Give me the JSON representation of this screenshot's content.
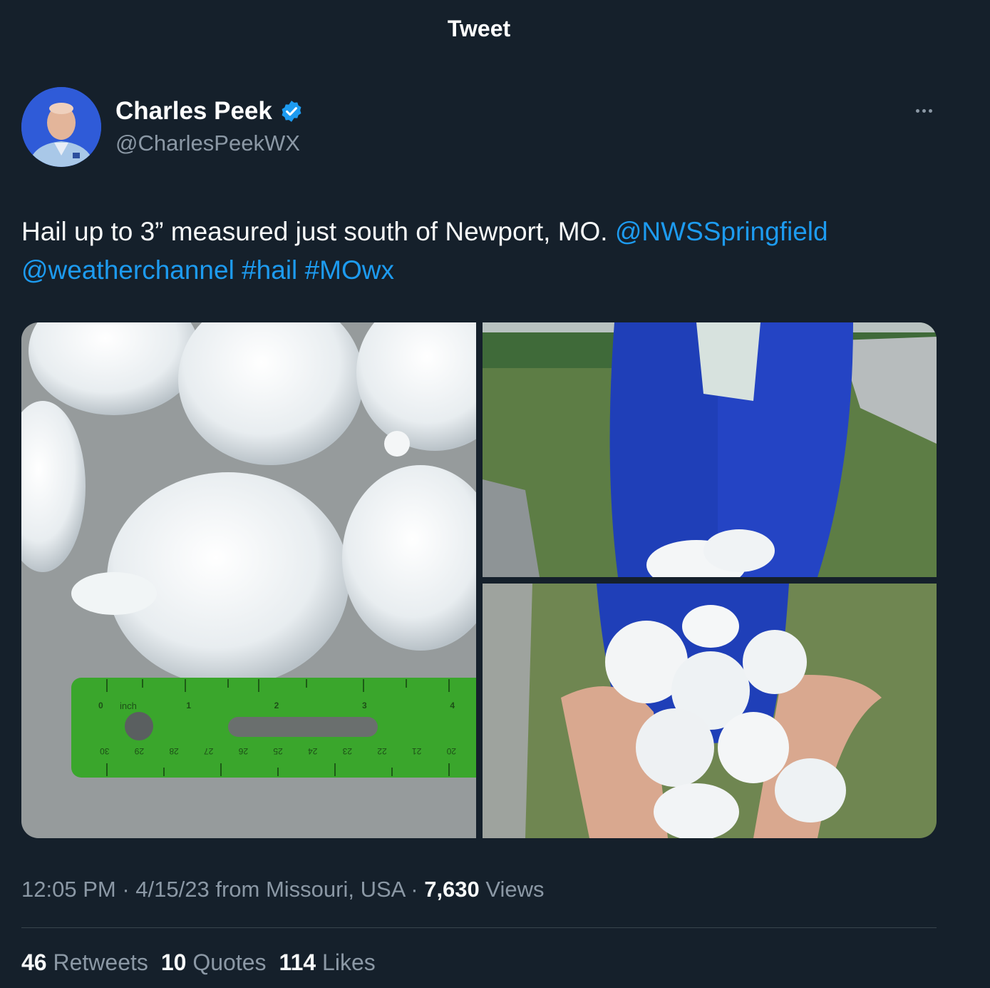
{
  "header": {
    "title": "Tweet"
  },
  "author": {
    "name": "Charles Peek",
    "handle": "@CharlesPeekWX",
    "verified_color": "#1d9bf0"
  },
  "tweet": {
    "text_main": "Hail up to 3” measured just south of Newport, MO.",
    "mention_1": "@NWSSpringfield",
    "mention_2": "@weatherchannel",
    "hashtag_1": "#hail",
    "hashtag_2": "#MOwx"
  },
  "media": {
    "ruler_inch_label": "inch",
    "ruler_top_numbers": [
      "0",
      "1",
      "2",
      "3",
      "4"
    ],
    "ruler_bottom_numbers": [
      "30",
      "29",
      "28",
      "27",
      "26",
      "25",
      "24",
      "23",
      "22",
      "21",
      "20"
    ]
  },
  "meta": {
    "time": "12:05 PM",
    "date": "4/15/23",
    "source": "from Missouri, USA",
    "views_count": "7,630",
    "views_label": "Views"
  },
  "stats": {
    "retweets_count": "46",
    "retweets_label": "Retweets",
    "quotes_count": "10",
    "quotes_label": "Quotes",
    "likes_count": "114",
    "likes_label": "Likes"
  },
  "colors": {
    "background": "#15202b",
    "link": "#1d9bf0",
    "secondary_text": "#8b98a5",
    "ruler_green": "#3aa62c",
    "jacket_blue": "#1f3fb8"
  }
}
